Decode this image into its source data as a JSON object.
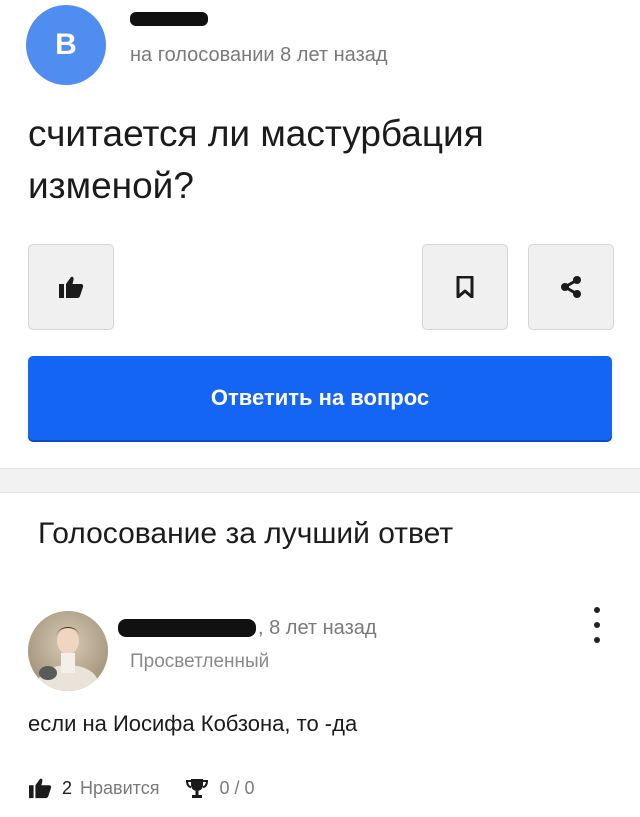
{
  "question": {
    "author_avatar_letter": "B",
    "meta": "на голосовании 8 лет назад",
    "title": "считается ли мастурбация изменой?",
    "answer_button_label": "Ответить на вопрос",
    "icons": [
      "thumbs-up-icon",
      "bookmark-icon",
      "share-icon"
    ]
  },
  "voting": {
    "heading": "Голосование за лучший ответ"
  },
  "answer": {
    "meta": ", 8 лет назад",
    "rank": "Просветленный",
    "text": "если на Иосифа Кобзона, то -да",
    "likes_count": "2",
    "likes_label": "Нравится",
    "votes": "0 / 0"
  },
  "colors": {
    "primary_button": "#1565f4",
    "avatar_blue": "#4f8ef0",
    "meta_gray": "#7a7a7a"
  }
}
